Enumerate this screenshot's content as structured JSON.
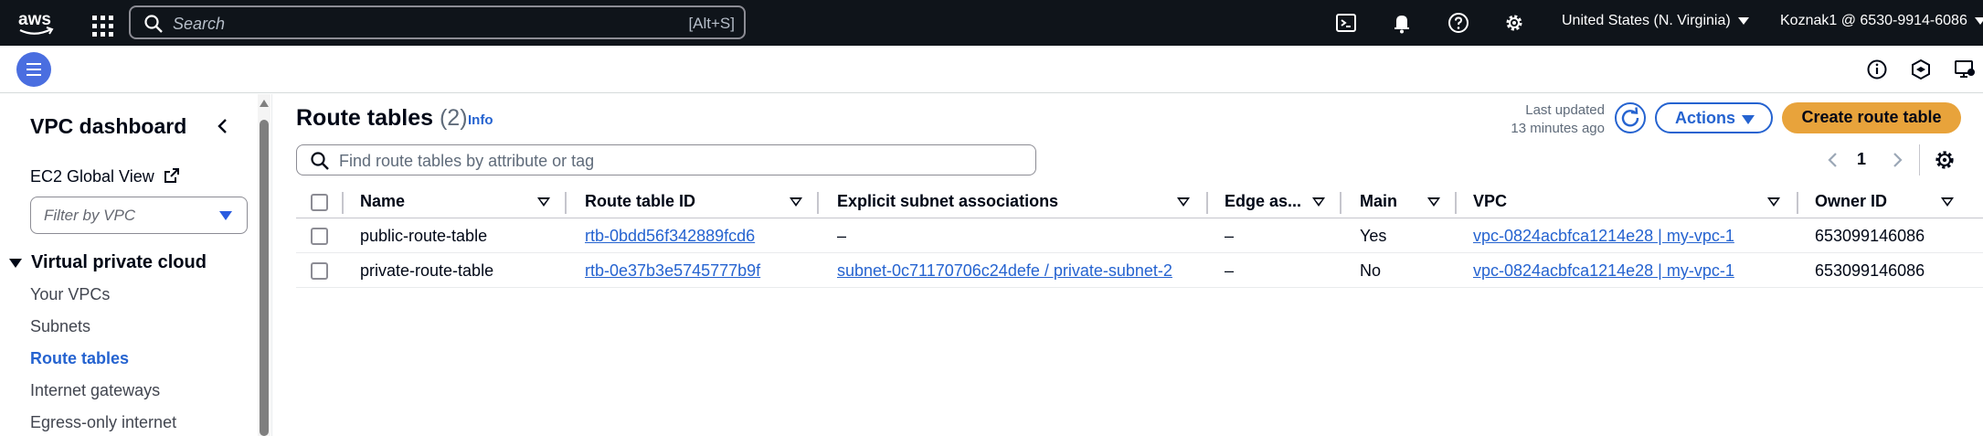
{
  "topbar": {
    "logo_text": "aws",
    "search": {
      "placeholder": "Search",
      "shortcut": "[Alt+S]"
    },
    "icons": [
      "cloudshell-icon",
      "bell-icon",
      "help-icon",
      "gear-icon"
    ],
    "region": "United States (N. Virginia)",
    "account": "Koznak1 @ 6530-9914-6086"
  },
  "sidebar": {
    "title": "VPC dashboard",
    "ec2_global_view": "EC2 Global View",
    "filter_placeholder": "Filter by VPC",
    "section": "Virtual private cloud",
    "items": [
      {
        "label": "Your VPCs",
        "active": false
      },
      {
        "label": "Subnets",
        "active": false
      },
      {
        "label": "Route tables",
        "active": true
      },
      {
        "label": "Internet gateways",
        "active": false
      },
      {
        "label": "Egress-only internet",
        "active": false
      }
    ]
  },
  "main": {
    "title": "Route tables",
    "count": "(2)",
    "info": "Info",
    "last_updated_line1": "Last updated",
    "last_updated_line2": "13 minutes ago",
    "actions_label": "Actions",
    "create_label": "Create route table",
    "find_placeholder": "Find route tables by attribute or tag",
    "page_number": "1",
    "columns": [
      "Name",
      "Route table ID",
      "Explicit subnet associations",
      "Edge as...",
      "Main",
      "VPC",
      "Owner ID"
    ],
    "rows": [
      {
        "name": "public-route-table",
        "route_table_id": "rtb-0bdd56f342889fcd6",
        "explicit_subnet": "–",
        "edge": "–",
        "main": "Yes",
        "vpc": "vpc-0824acbfca1214e28 | my-vpc-1",
        "owner_id": "653099146086"
      },
      {
        "name": "private-route-table",
        "route_table_id": "rtb-0e37b3e5745777b9f",
        "explicit_subnet": "subnet-0c71170706c24defe / private-subnet-2",
        "edge": "–",
        "main": "No",
        "vpc": "vpc-0824acbfca1214e28 | my-vpc-1",
        "owner_id": "653099146086"
      }
    ]
  },
  "colors": {
    "topbar_bg": "#0f141a",
    "link": "#2563d0",
    "primary_button": "#e8a33b",
    "menu_button": "#4a6ee0"
  }
}
